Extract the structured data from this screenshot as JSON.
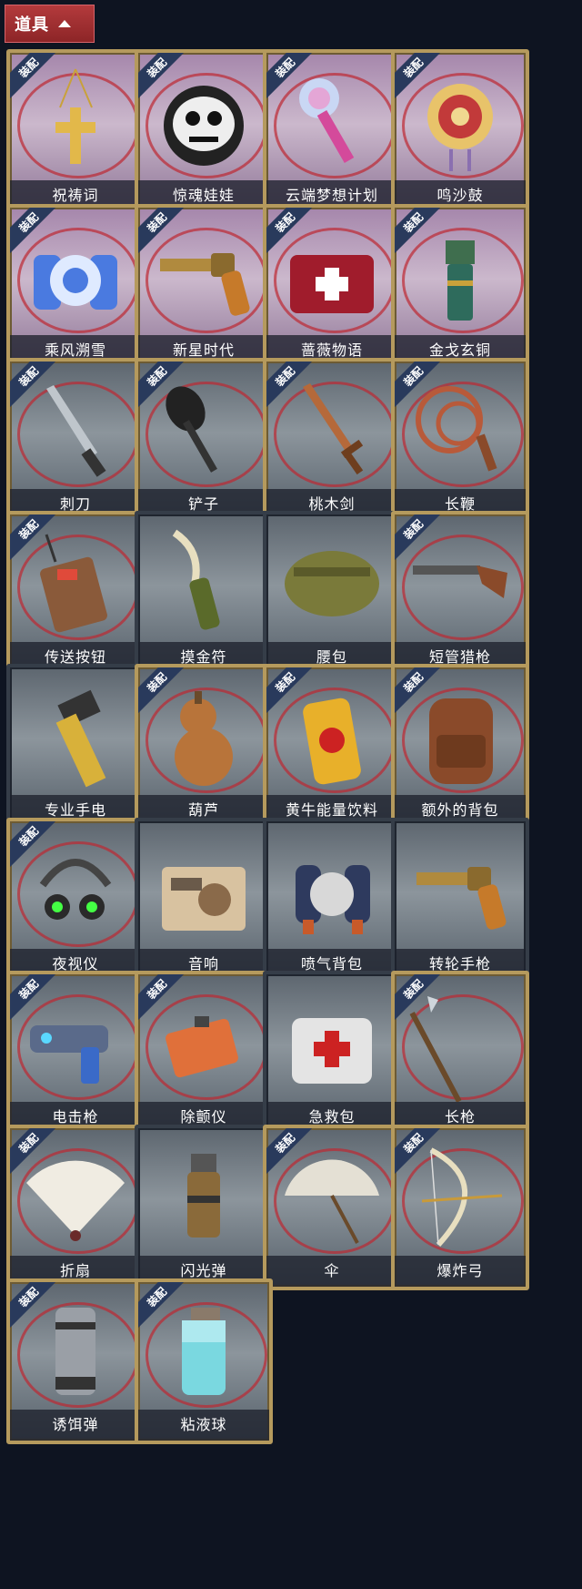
{
  "header": {
    "title": "道具"
  },
  "badge_text": "装配",
  "items": [
    {
      "name": "祝祷词",
      "icon": "cross-necklace-icon",
      "bg": "purple",
      "equip": true
    },
    {
      "name": "惊魂娃娃",
      "icon": "skull-doll-icon",
      "bg": "purple",
      "equip": true
    },
    {
      "name": "云端梦想计划",
      "icon": "dream-scepter-icon",
      "bg": "purple",
      "equip": true
    },
    {
      "name": "鸣沙鼓",
      "icon": "drum-icon",
      "bg": "purple",
      "equip": true
    },
    {
      "name": "乘风溯雪",
      "icon": "snow-jetpack-icon",
      "bg": "purple",
      "equip": true
    },
    {
      "name": "新星时代",
      "icon": "revolver-icon",
      "bg": "purple",
      "equip": true
    },
    {
      "name": "蔷薇物语",
      "icon": "medkit-icon",
      "bg": "purple",
      "equip": true
    },
    {
      "name": "金戈玄铜",
      "icon": "bronze-grenade-icon",
      "bg": "purple",
      "equip": true
    },
    {
      "name": "刺刀",
      "icon": "bayonet-icon",
      "bg": "grey",
      "equip": true
    },
    {
      "name": "铲子",
      "icon": "shovel-icon",
      "bg": "grey",
      "equip": true
    },
    {
      "name": "桃木剑",
      "icon": "wooden-sword-icon",
      "bg": "grey",
      "equip": true
    },
    {
      "name": "长鞭",
      "icon": "whip-icon",
      "bg": "grey",
      "equip": true
    },
    {
      "name": "传送按钮",
      "icon": "remote-icon",
      "bg": "grey",
      "equip": true
    },
    {
      "name": "摸金符",
      "icon": "talisman-icon",
      "bg": "grey",
      "equip": false
    },
    {
      "name": "腰包",
      "icon": "waist-bag-icon",
      "bg": "grey",
      "equip": false
    },
    {
      "name": "短管猎枪",
      "icon": "shotgun-icon",
      "bg": "grey",
      "equip": true
    },
    {
      "name": "专业手电",
      "icon": "flashlight-icon",
      "bg": "grey",
      "equip": false
    },
    {
      "name": "葫芦",
      "icon": "gourd-icon",
      "bg": "grey",
      "equip": true
    },
    {
      "name": "黄牛能量饮料",
      "icon": "energy-drink-icon",
      "bg": "grey",
      "equip": true
    },
    {
      "name": "额外的背包",
      "icon": "backpack-icon",
      "bg": "grey",
      "equip": true
    },
    {
      "name": "夜视仪",
      "icon": "night-vision-icon",
      "bg": "grey",
      "equip": true
    },
    {
      "name": "音响",
      "icon": "radio-icon",
      "bg": "grey",
      "equip": false
    },
    {
      "name": "喷气背包",
      "icon": "jetpack-icon",
      "bg": "grey",
      "equip": false
    },
    {
      "name": "转轮手枪",
      "icon": "revolver-icon",
      "bg": "grey",
      "equip": false
    },
    {
      "name": "电击枪",
      "icon": "stun-gun-icon",
      "bg": "grey",
      "equip": true
    },
    {
      "name": "除颤仪",
      "icon": "defibrillator-icon",
      "bg": "grey",
      "equip": true
    },
    {
      "name": "急救包",
      "icon": "first-aid-icon",
      "bg": "grey",
      "equip": false
    },
    {
      "name": "长枪",
      "icon": "spear-icon",
      "bg": "grey",
      "equip": true
    },
    {
      "name": "折扇",
      "icon": "folding-fan-icon",
      "bg": "grey",
      "equip": true
    },
    {
      "name": "闪光弹",
      "icon": "flashbang-icon",
      "bg": "grey",
      "equip": false
    },
    {
      "name": "伞",
      "icon": "umbrella-icon",
      "bg": "grey",
      "equip": true
    },
    {
      "name": "爆炸弓",
      "icon": "bow-icon",
      "bg": "grey",
      "equip": true
    },
    {
      "name": "诱饵弹",
      "icon": "decoy-canister-icon",
      "bg": "grey",
      "equip": true
    },
    {
      "name": "粘液球",
      "icon": "slime-jar-icon",
      "bg": "grey",
      "equip": true
    }
  ]
}
